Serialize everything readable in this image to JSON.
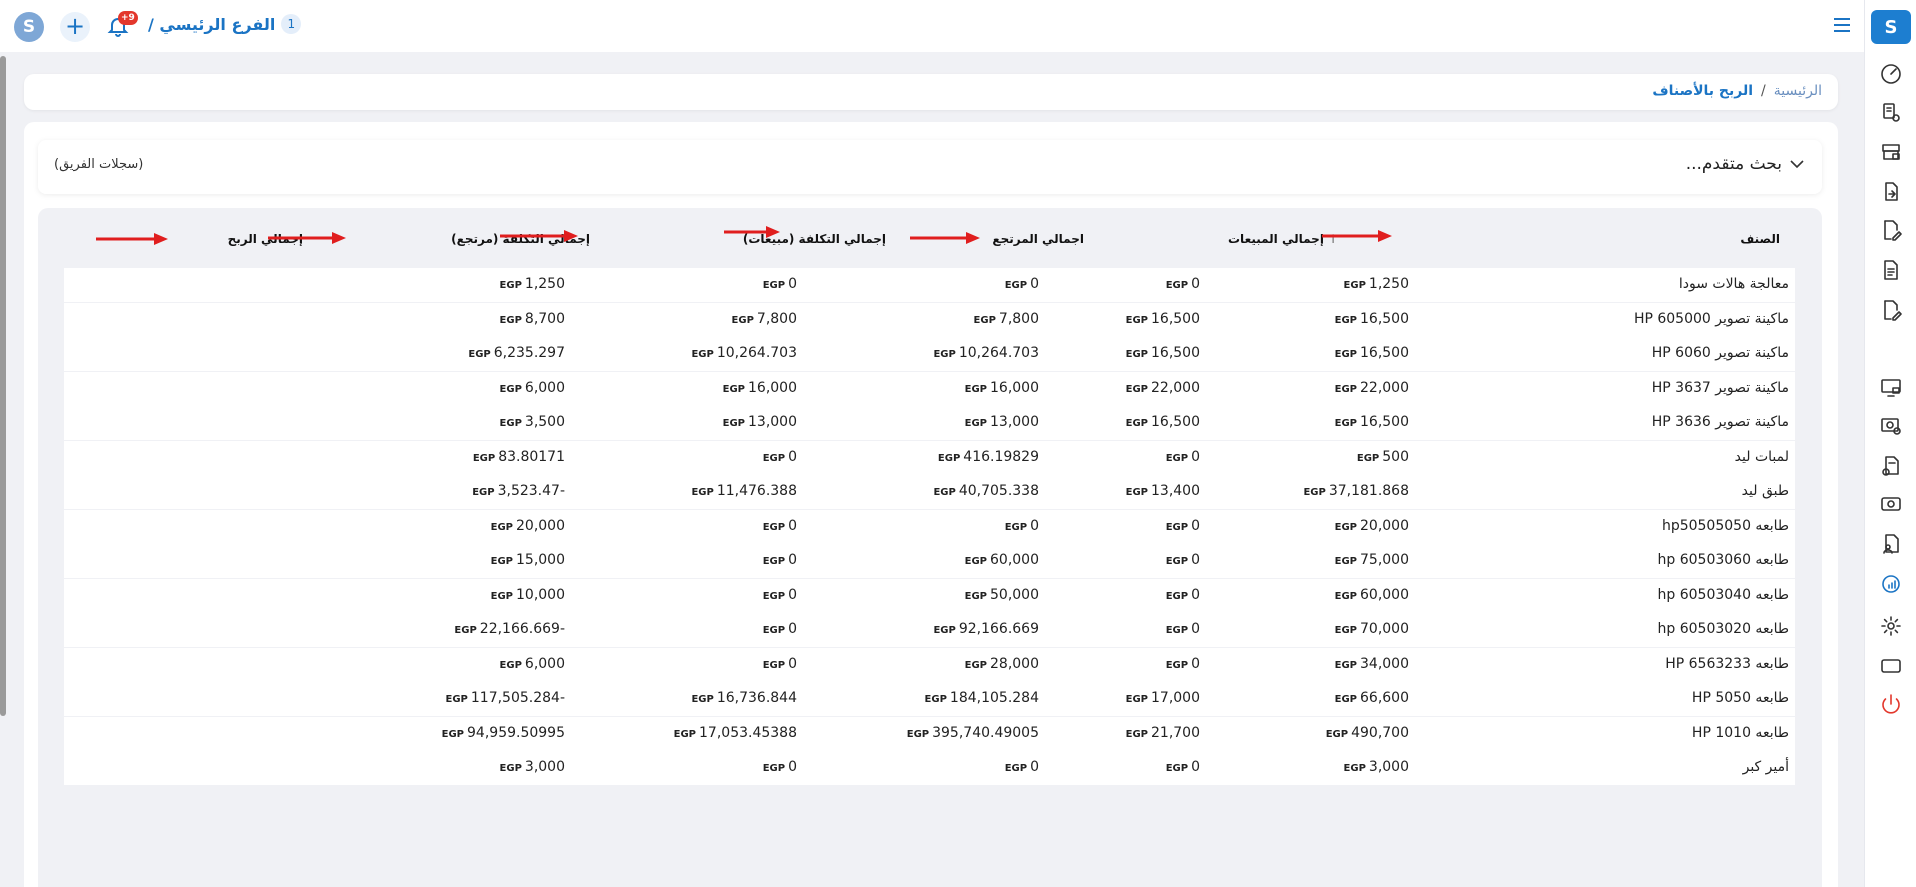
{
  "topbar": {
    "logo_text": "S",
    "plus_label": "+",
    "notifications_badge": "+9",
    "branch_number": "1",
    "branch_name": "الفرع الرئيسي /"
  },
  "breadcrumb": {
    "home": "الرئيسية",
    "separator": "/",
    "current": "الربح بالأصناف"
  },
  "search": {
    "advanced_label": "بحث متقدم...",
    "team_records": "(سجلات الفريق)"
  },
  "currency": "EGP",
  "columns": {
    "item": "الصنف",
    "total_sales": "إجمالي المبيعات",
    "total_returns": "اجمالي المرتجع",
    "cost_sales": "إجمالي التكلفة (مبيعات)",
    "cost_returns": "إجمالي التكلفة (مرتجع)",
    "total_profit": "إجمالي الربح"
  },
  "rows": [
    {
      "item": "معالجة هالات سودا",
      "sales": "1,250",
      "returns": "0",
      "cost_sales": "0",
      "cost_returns": "0",
      "profit": "1,250"
    },
    {
      "item": "ماكينة تصوير HP 605000",
      "sales": "16,500",
      "returns": "16,500",
      "cost_sales": "7,800",
      "cost_returns": "7,800",
      "profit": "8,700"
    },
    {
      "item": "ماكينة تصوير HP 6060",
      "sales": "16,500",
      "returns": "16,500",
      "cost_sales": "10,264.703",
      "cost_returns": "10,264.703",
      "profit": "6,235.297"
    },
    {
      "item": "ماكينة تصوير HP 3637",
      "sales": "22,000",
      "returns": "22,000",
      "cost_sales": "16,000",
      "cost_returns": "16,000",
      "profit": "6,000"
    },
    {
      "item": "ماكينة تصوير HP 3636",
      "sales": "16,500",
      "returns": "16,500",
      "cost_sales": "13,000",
      "cost_returns": "13,000",
      "profit": "3,500"
    },
    {
      "item": "لمبات ليد",
      "sales": "500",
      "returns": "0",
      "cost_sales": "416.19829",
      "cost_returns": "0",
      "profit": "83.80171"
    },
    {
      "item": "طبق ليد",
      "sales": "37,181.868",
      "returns": "13,400",
      "cost_sales": "40,705.338",
      "cost_returns": "11,476.388",
      "profit": "3,523.47-"
    },
    {
      "item": "طابعه hp50505050",
      "sales": "20,000",
      "returns": "0",
      "cost_sales": "0",
      "cost_returns": "0",
      "profit": "20,000"
    },
    {
      "item": "طابعه hp 60503060",
      "sales": "75,000",
      "returns": "0",
      "cost_sales": "60,000",
      "cost_returns": "0",
      "profit": "15,000"
    },
    {
      "item": "طابعه hp 60503040",
      "sales": "60,000",
      "returns": "0",
      "cost_sales": "50,000",
      "cost_returns": "0",
      "profit": "10,000"
    },
    {
      "item": "طابعه hp 60503020",
      "sales": "70,000",
      "returns": "0",
      "cost_sales": "92,166.669",
      "cost_returns": "0",
      "profit": "22,166.669-"
    },
    {
      "item": "طابعه HP 6563233",
      "sales": "34,000",
      "returns": "0",
      "cost_sales": "28,000",
      "cost_returns": "0",
      "profit": "6,000"
    },
    {
      "item": "طابعه HP 5050",
      "sales": "66,600",
      "returns": "17,000",
      "cost_sales": "184,105.284",
      "cost_returns": "16,736.844",
      "profit": "117,505.284-"
    },
    {
      "item": "طابعه HP 1010",
      "sales": "490,700",
      "returns": "21,700",
      "cost_sales": "395,740.49005",
      "cost_returns": "17,053.45388",
      "profit": "94,959.50995"
    },
    {
      "item": "أمير كبر",
      "sales": "3,000",
      "returns": "0",
      "cost_sales": "0",
      "cost_returns": "0",
      "profit": "3,000"
    }
  ],
  "colors": {
    "accent": "#1b74c4",
    "sidebar_logo": "#1d7ed0",
    "annotation_arrow": "#e01e1e",
    "power": "#e3372c"
  },
  "sidebar_icons": [
    "dashboard-icon",
    "pos-icon",
    "store-icon",
    "file-transfer-icon",
    "edit-doc-icon",
    "document-icon",
    "edit-doc-icon",
    "monitor-icon",
    "money-add-icon",
    "add-doc-icon",
    "cash-icon",
    "user-doc-icon",
    "report-chart-icon",
    "settings-icon",
    "window-icon",
    "power-icon"
  ]
}
